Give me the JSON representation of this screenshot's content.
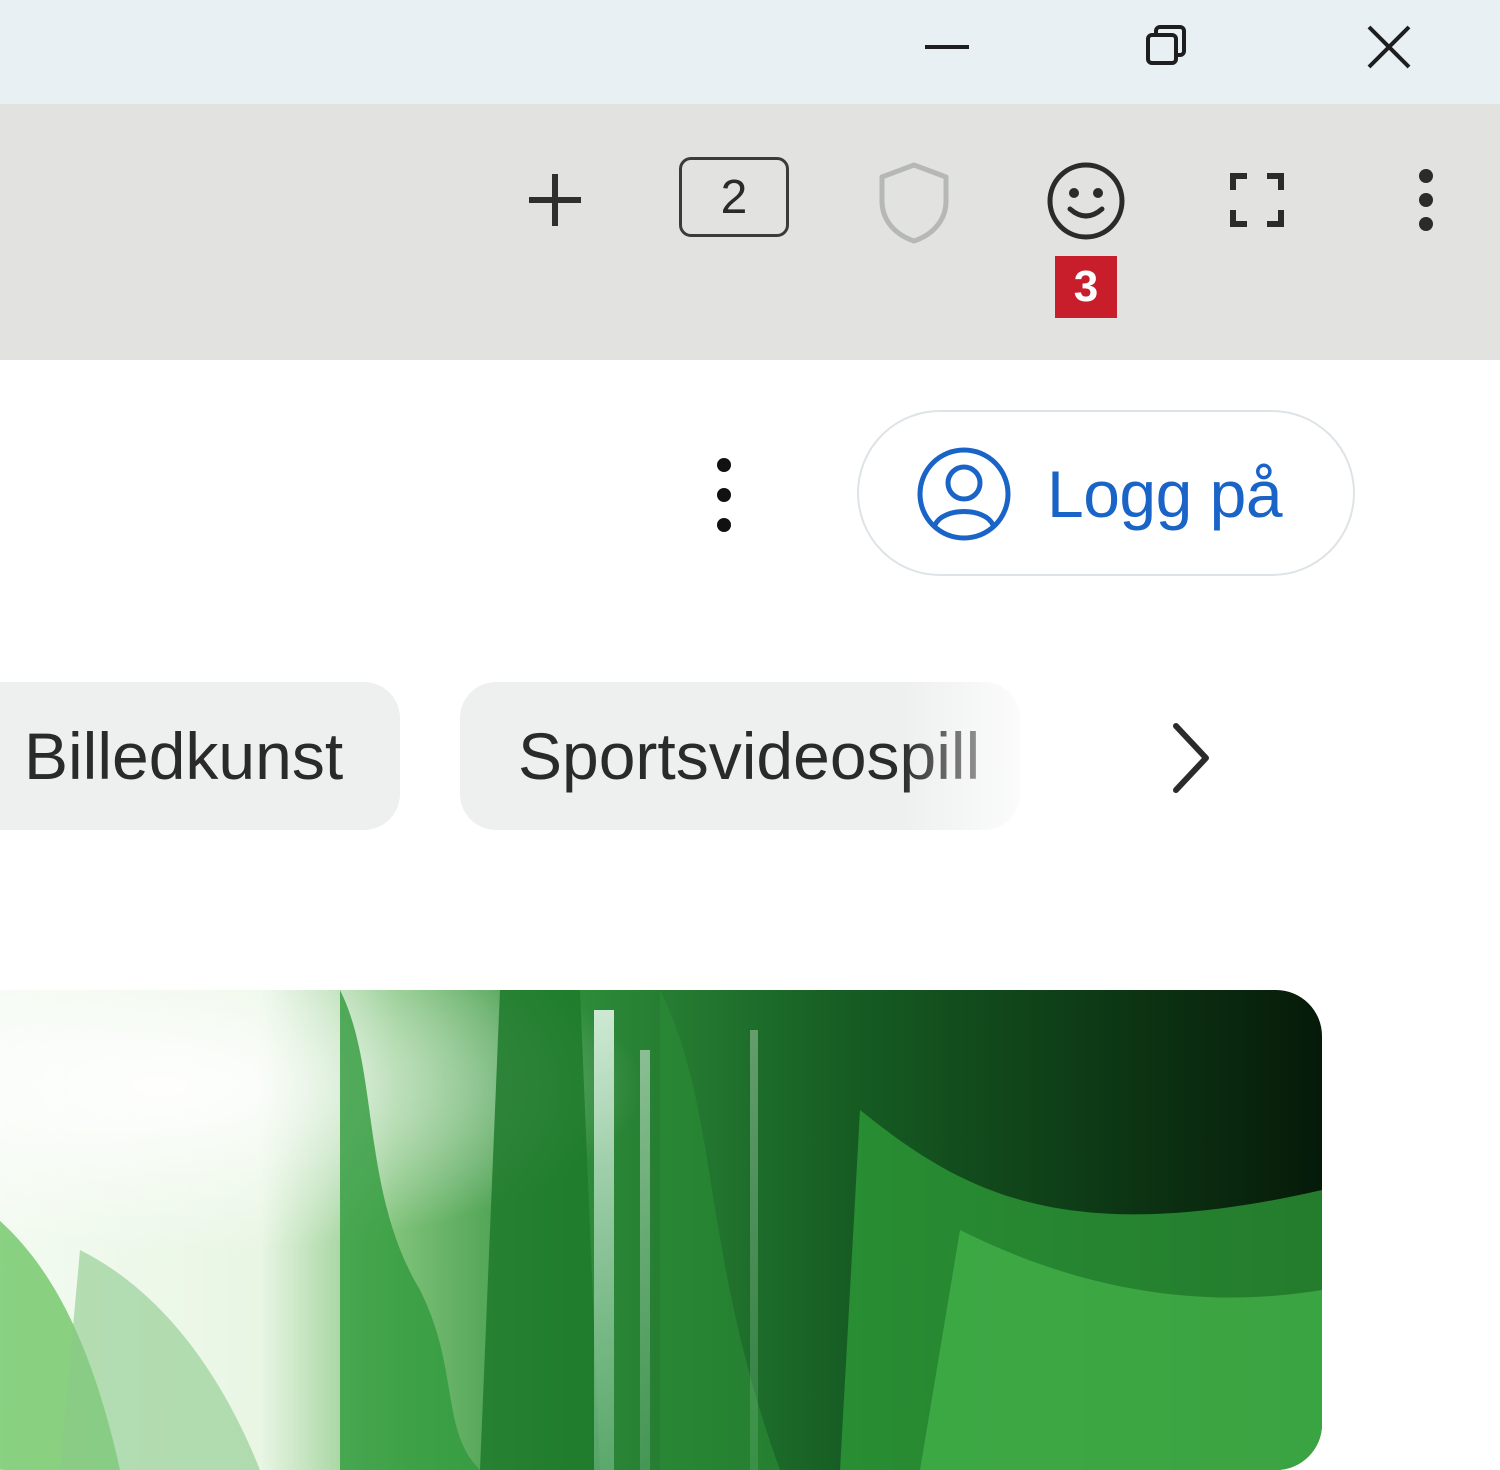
{
  "window_controls": {
    "minimize_icon": "minimize-icon",
    "restore_icon": "restore-icon",
    "close_icon": "close-icon"
  },
  "toolbar": {
    "new_tab_icon": "plus-icon",
    "tab_count": "2",
    "shield_icon": "shield-icon",
    "emoji_icon": "smiley-icon",
    "emoji_badge": "3",
    "fullscreen_icon": "fullscreen-icon",
    "menu_icon": "more-vertical-icon"
  },
  "page": {
    "more_icon": "more-vertical-icon",
    "login_label": "Logg på",
    "login_icon": "user-circle-icon",
    "categories": [
      "Billedkunst",
      "Sportsvideospill"
    ],
    "next_icon": "chevron-right-icon",
    "hero_image": "forest-waterfall-image"
  },
  "colors": {
    "titlebar_bg": "#e8f0f3",
    "toolbar_bg": "#e2e3e1",
    "badge_red": "#c81e2c",
    "link_blue": "#1a64c8",
    "chip_bg": "#eef0ef"
  }
}
